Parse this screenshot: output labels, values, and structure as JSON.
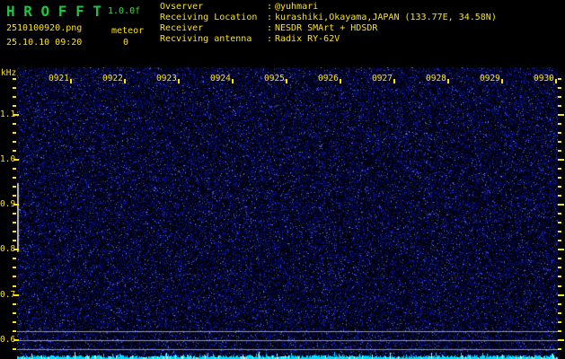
{
  "app": {
    "title": "H R O F F T",
    "version": "1.0.0f",
    "filename": "2510100920.png",
    "timestamp": "25.10.10 09:20",
    "meteor_label": "meteor",
    "meteor_count": "0"
  },
  "observer_info": {
    "rows": [
      {
        "label": "Ovserver",
        "sep": ":",
        "value": "@yuhmari"
      },
      {
        "label": "Receiving Location",
        "sep": ":",
        "value": "kurashiki,Okayama,JAPAN (133.77E, 34.58N)"
      },
      {
        "label": "Receiver",
        "sep": ":",
        "value": "NESDR SMArt + HDSDR"
      },
      {
        "label": "Recviving antenna",
        "sep": ":",
        "value": "Radix RY-62V"
      }
    ]
  },
  "spectrogram": {
    "y_axis_unit": "kHz",
    "y_labels": [
      "1.1",
      "1.0",
      "0.9",
      "0.8",
      "0.7",
      "0.6"
    ],
    "x_labels": [
      "0921",
      "0922",
      "0923",
      "0924",
      "0925",
      "0926",
      "0927",
      "0928",
      "0929",
      "0930"
    ],
    "colors": {
      "background": "#000008",
      "noise_dim": "#000050",
      "noise_mid": "#1a2cc8",
      "noise_bright": "#5a7cf0",
      "axis_text": "#ffe400",
      "title_green": "#17c93f",
      "version_green": "#2ee22e",
      "grid_line": "#989898",
      "marker_line": "#b5b5b5",
      "signal_trace": "#00dcfa"
    }
  }
}
